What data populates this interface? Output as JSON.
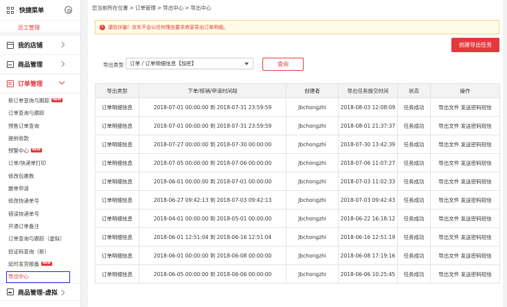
{
  "sidebar": {
    "quick_menu_title": "快捷菜单",
    "quick_menu_item": "员工管理",
    "sections": {
      "store": "我的店铺",
      "goods": "商品管理",
      "orders": "订单管理",
      "goods_virtual": "商品管理-虚拟"
    },
    "order_items": [
      {
        "label": "新订单查询与跟踪",
        "badge": "NEW"
      },
      {
        "label": "订单查询与跟踪",
        "badge": ""
      },
      {
        "label": "预售订单查询",
        "badge": ""
      },
      {
        "label": "提前收款",
        "badge": ""
      },
      {
        "label": "预警中心",
        "badge": "NEW"
      },
      {
        "label": "订单/快递单打印",
        "badge": ""
      },
      {
        "label": "修改包裹数",
        "badge": ""
      },
      {
        "label": "删单申请",
        "badge": ""
      },
      {
        "label": "修改快递单号",
        "badge": ""
      },
      {
        "label": "错误快递单号",
        "badge": ""
      },
      {
        "label": "开通订单备注",
        "badge": ""
      },
      {
        "label": "订单查询与跟踪（虚拟）",
        "badge": ""
      },
      {
        "label": "验证码查询（新）",
        "badge": ""
      },
      {
        "label": "延时发货报备",
        "badge": "NEW"
      },
      {
        "label": "导出中心",
        "badge": ""
      }
    ],
    "accent_color": "#e4393c"
  },
  "main": {
    "breadcrumb": [
      "您当前所在位置",
      ">",
      "订单管理",
      ">",
      "导出中心",
      ">",
      "导出中心"
    ],
    "alert_text": "谨防诈骗！京东不会以任何理由要求商家导出订单明细。",
    "create_button": "创建导出任务",
    "filter_label": "导出类型",
    "filter_value": "订单 / 订单明细信息【加密】",
    "query_button": "查询",
    "columns": [
      "导出类型",
      "下单/核销/申请时间段",
      "创建者",
      "导出任务提交时间",
      "状态",
      "操作"
    ],
    "rows": [
      {
        "type": "订单明细信息",
        "range": "2018-07-01 00:00:00 到 2018-07-31 23:59:59",
        "creator": "Jbchongzhi",
        "submitted": "2018-08-03 12:08:09",
        "status": "任务成功",
        "actions": "导出文件 发送密码短信"
      },
      {
        "type": "订单明细信息",
        "range": "2018-07-01 00:00:00 到 2018-07-31 23:59:59",
        "creator": "Jbchongzhi",
        "submitted": "2018-08-01 21:37:37",
        "status": "任务成功",
        "actions": "导出文件 发送密码短信"
      },
      {
        "type": "订单明细信息",
        "range": "2018-07-27 00:00:00 到 2018-07-30 00:00:00",
        "creator": "Jbchongzhi",
        "submitted": "2018-07-30 13:42:39",
        "status": "任务成功",
        "actions": "导出文件 发送密码短信"
      },
      {
        "type": "订单明细信息",
        "range": "2018-07-05 00:00:00 到 2018-07-06 00:00:00",
        "creator": "Jbchongzhi",
        "submitted": "2018-07-06 11:07:27",
        "status": "任务成功",
        "actions": "导出文件 发送密码短信"
      },
      {
        "type": "订单明细信息",
        "range": "2018-06-01 00:00:00 到 2018-07-01 00:00:00",
        "creator": "Jbchongzhi",
        "submitted": "2018-07-03 11:02:33",
        "status": "任务成功",
        "actions": "导出文件 发送密码短信"
      },
      {
        "type": "订单明细信息",
        "range": "2018-06-27 09:42:13 到 2018-07-03 09:42:13",
        "creator": "Jbchongzhi",
        "submitted": "2018-07-03 09:42:43",
        "status": "任务成功",
        "actions": "导出文件 发送密码短信"
      },
      {
        "type": "订单明细信息",
        "range": "2018-04-01 00:00:00 到 2018-05-01 00:00:00",
        "creator": "Jbchongzhi",
        "submitted": "2018-06-22 16:18:12",
        "status": "任务成功",
        "actions": "导出文件 发送密码短信"
      },
      {
        "type": "订单明细信息",
        "range": "2018-06-01 12:51:04 到 2018-06-16 12:51:04",
        "creator": "Jbchongzhi",
        "submitted": "2018-06-16 12:51:19",
        "status": "任务成功",
        "actions": "导出文件 发送密码短信"
      },
      {
        "type": "订单明细信息",
        "range": "2018-06-01 00:00:00 到 2018-06-08 00:00:00",
        "creator": "Jbchongzhi",
        "submitted": "2018-06-08 17:19:16",
        "status": "任务成功",
        "actions": "导出文件 发送密码短信"
      },
      {
        "type": "订单明细信息",
        "range": "2018-06-05 00:00:00 到 2018-06-06 00:00:00",
        "creator": "Jbchongzhi",
        "submitted": "2018-06-06 10:25:45",
        "status": "任务成功",
        "actions": "导出文件 发送密码短信"
      }
    ]
  }
}
